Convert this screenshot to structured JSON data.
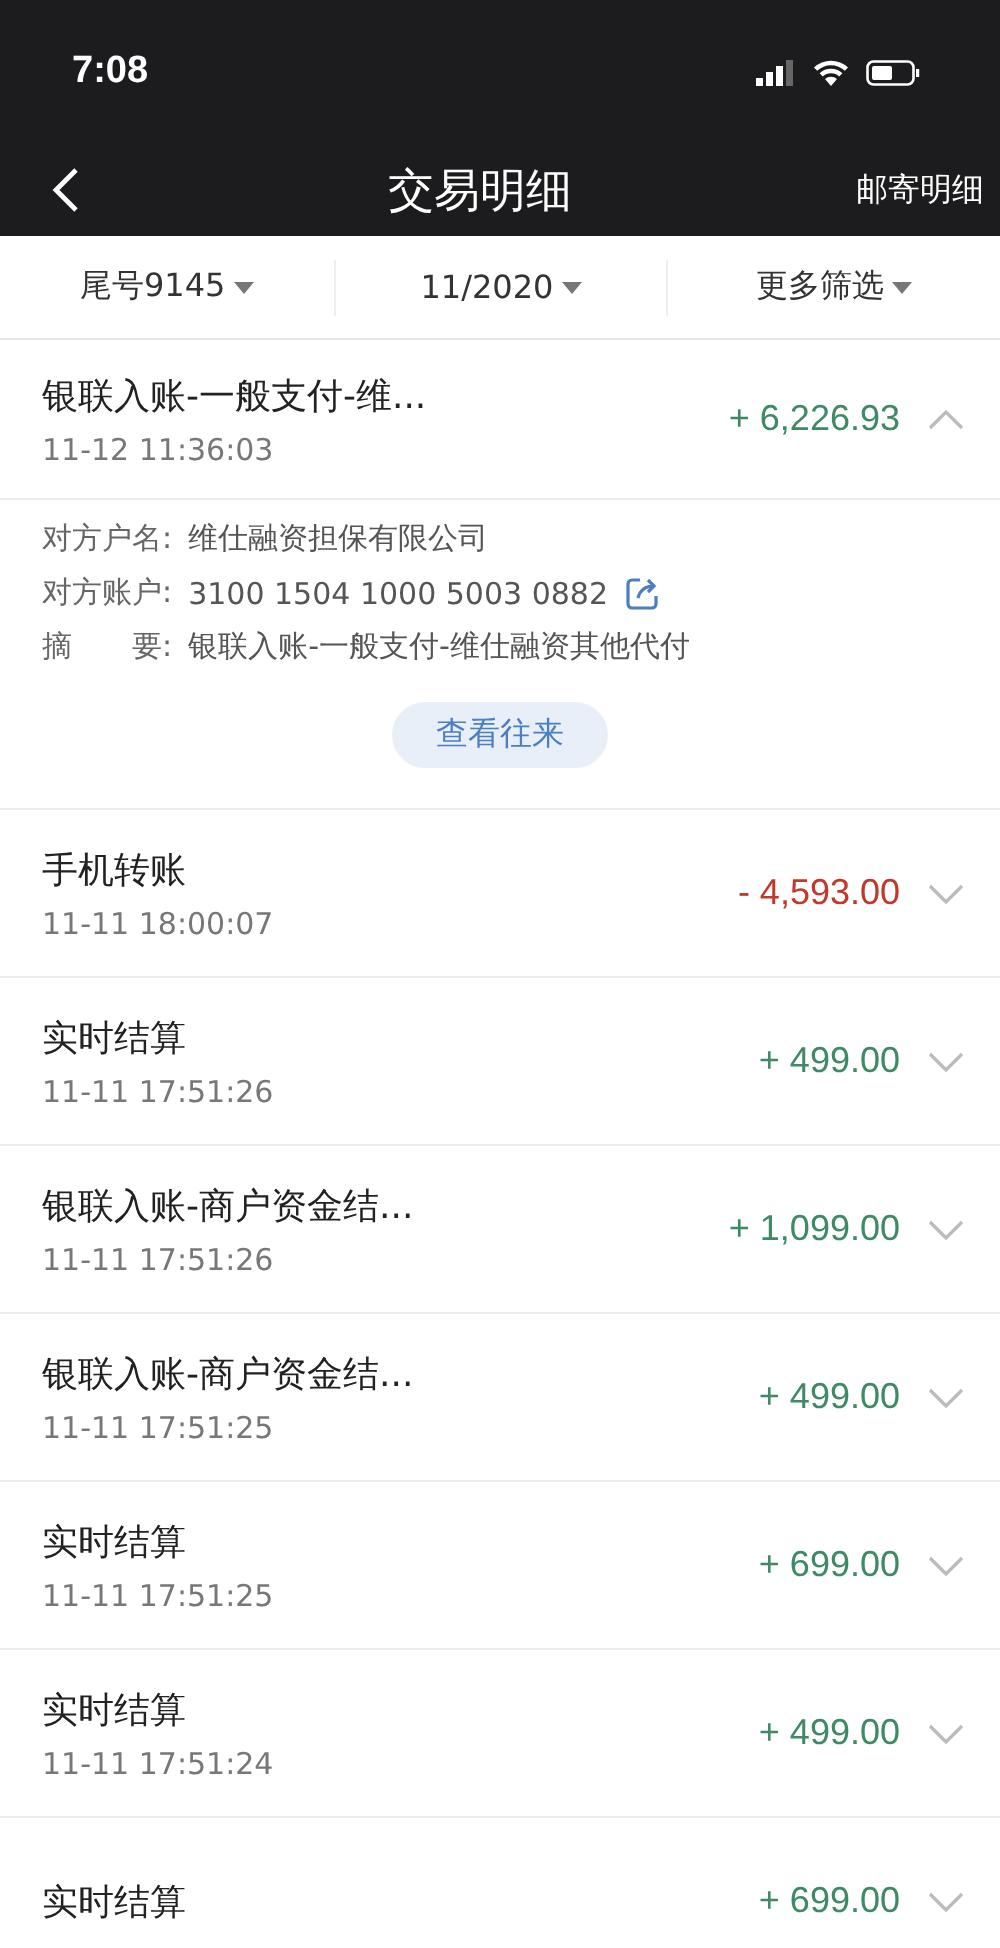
{
  "status_bar": {
    "time": "7:08"
  },
  "nav": {
    "title": "交易明细",
    "action": "邮寄明细"
  },
  "filters": [
    {
      "label": "尾号9145"
    },
    {
      "label": "11/2020"
    },
    {
      "label": "更多筛选"
    }
  ],
  "transactions": [
    {
      "title": "银联入账-一般支付-维...",
      "time": "11-12 11:36:03",
      "amount": "+ 6,226.93",
      "kind": "credit",
      "expanded": true,
      "details": [
        {
          "label": "对方户名:",
          "value": "维仕融资担保有限公司"
        },
        {
          "label": "对方账户:",
          "value": "3100 1504 1000 5003 0882",
          "kind": "account"
        },
        {
          "label": "摘　　要:",
          "value": "银联入账-一般支付-维仕融资其他代付"
        }
      ],
      "action": "查看往来"
    },
    {
      "title": "手机转账",
      "time": "11-11 18:00:07",
      "amount": "- 4,593.00",
      "kind": "debit",
      "expanded": false
    },
    {
      "title": "实时结算",
      "time": "11-11 17:51:26",
      "amount": "+ 499.00",
      "kind": "credit",
      "expanded": false
    },
    {
      "title": "银联入账-商户资金结...",
      "time": "11-11 17:51:26",
      "amount": "+ 1,099.00",
      "kind": "credit",
      "expanded": false
    },
    {
      "title": "银联入账-商户资金结...",
      "time": "11-11 17:51:25",
      "amount": "+ 499.00",
      "kind": "credit",
      "expanded": false
    },
    {
      "title": "实时结算",
      "time": "11-11 17:51:25",
      "amount": "+ 699.00",
      "kind": "credit",
      "expanded": false
    },
    {
      "title": "实时结算",
      "time": "11-11 17:51:24",
      "amount": "+ 499.00",
      "kind": "credit",
      "expanded": false
    },
    {
      "title": "实时结算",
      "amount": "+ 699.00",
      "kind": "credit",
      "expanded": false
    }
  ]
}
